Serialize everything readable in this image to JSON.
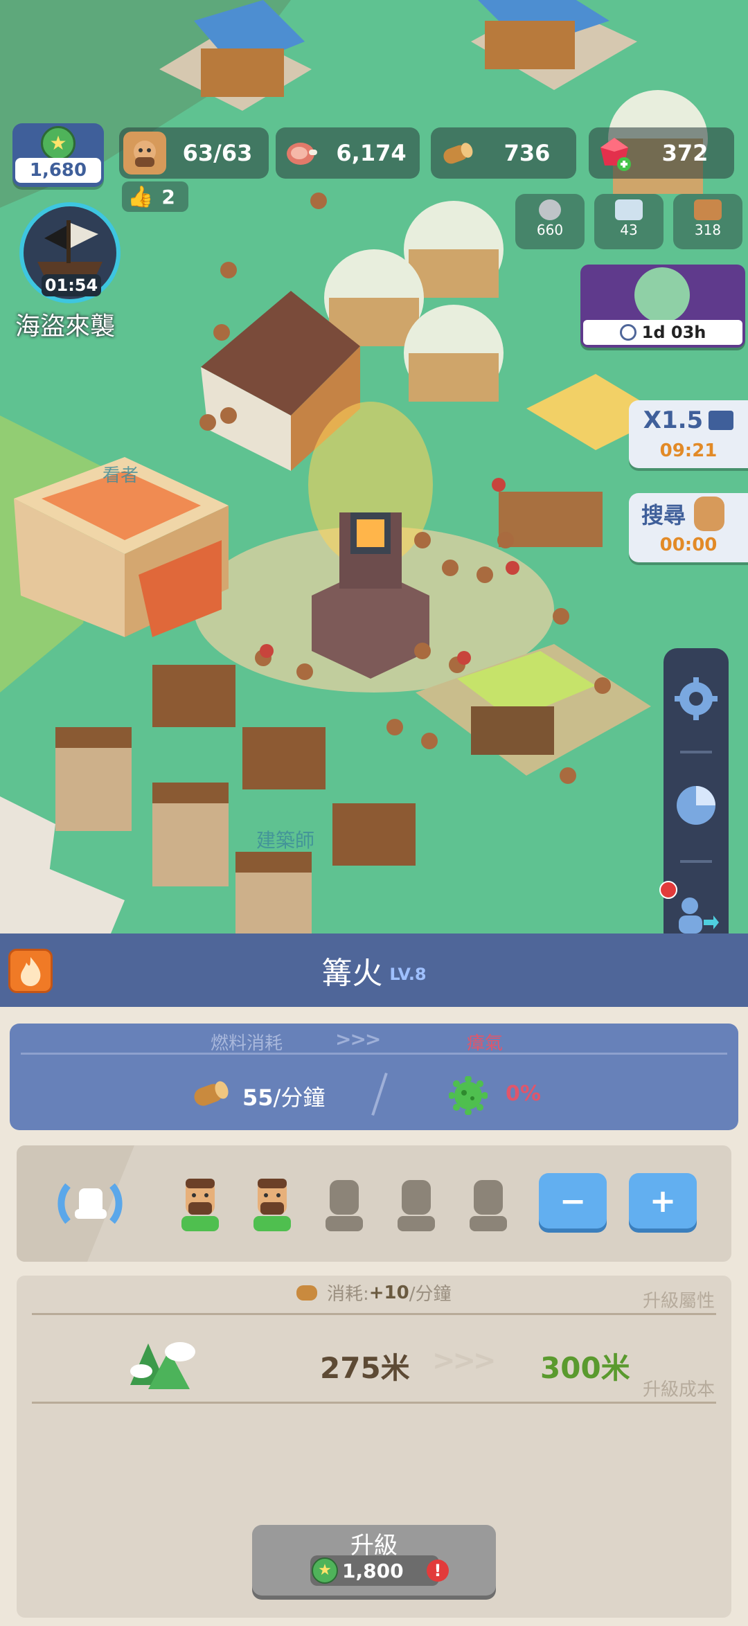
{
  "hud": {
    "xp_value": "1,680",
    "population": "63/63",
    "likes": "2",
    "meat": "6,174",
    "wood": "736",
    "gems": "372",
    "stone": "660",
    "iron": "43",
    "planks": "318"
  },
  "event": {
    "timer": "01:54",
    "title": "海盜來襲"
  },
  "zombie_event": {
    "timer": "1d 03h"
  },
  "speed_card": {
    "label": "X1.5",
    "timer": "09:21"
  },
  "search_card": {
    "label": "搜尋",
    "timer": "00:00"
  },
  "map_labels": {
    "label1": "看者",
    "label2": "建築師"
  },
  "sidebar_icons": [
    "gear-icon",
    "pie-chart-icon",
    "person-exit-icon"
  ],
  "panel": {
    "title": "篝火",
    "level": "LV.8",
    "fuel_label": "燃料消耗",
    "smog_label": "瘴氣",
    "fuel_value": "55",
    "fuel_unit": "/分鐘",
    "smog_value": "0%",
    "workers_filled": 2,
    "workers_total": 5,
    "minus_label": "−",
    "plus_label": "+",
    "consume_label": "消耗:",
    "consume_value": "+10",
    "consume_unit": "/分鐘",
    "upgrade_attr_label": "升級屬性",
    "range_current": "275米",
    "range_next": "300米",
    "upgrade_cost_label": "升級成本",
    "upgrade_button": "升級",
    "upgrade_cost": "1,800"
  },
  "colors": {
    "panel_header": "#4f6699",
    "fuel_box": "#6781b9",
    "smog_red": "#e0566b",
    "next_value_green": "#5a9a2e",
    "button_blue": "#62aff0"
  }
}
